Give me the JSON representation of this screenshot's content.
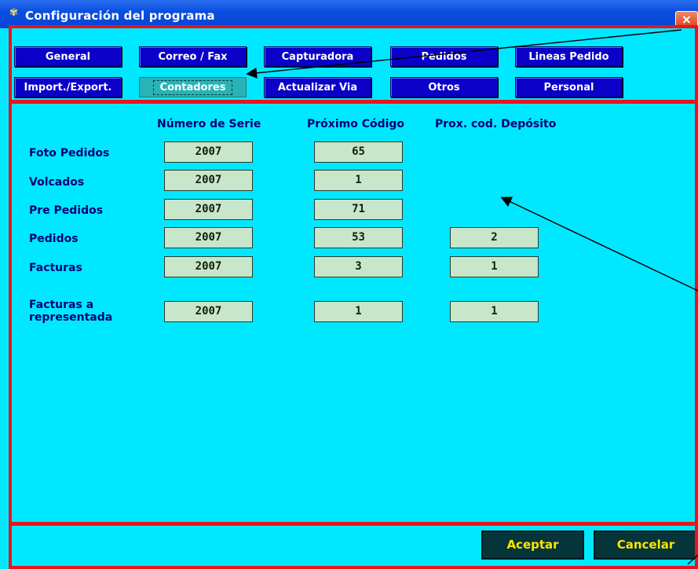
{
  "window": {
    "title": "Configuración del programa",
    "close_label": "×"
  },
  "tabs": [
    {
      "label": "General",
      "active": false
    },
    {
      "label": "Correo / Fax",
      "active": false
    },
    {
      "label": "Capturadora",
      "active": false
    },
    {
      "label": "Pedidos",
      "active": false
    },
    {
      "label": "Lineas Pedido",
      "active": false
    },
    {
      "label": "Import./Export.",
      "active": false
    },
    {
      "label": "Contadores",
      "active": true
    },
    {
      "label": "Actualizar Via",
      "active": false
    },
    {
      "label": "Otros",
      "active": false
    },
    {
      "label": "Personal",
      "active": false
    }
  ],
  "counters": {
    "headers": {
      "serie": "Número de Serie",
      "codigo": "Próximo Código",
      "deposito": "Prox. cod. Depósito"
    },
    "rows": [
      {
        "label": "Foto Pedidos",
        "serie": "2007",
        "codigo": "65",
        "deposito": null
      },
      {
        "label": "Volcados",
        "serie": "2007",
        "codigo": "1",
        "deposito": null
      },
      {
        "label": "Pre Pedidos",
        "serie": "2007",
        "codigo": "71",
        "deposito": null
      },
      {
        "label": "Pedidos",
        "serie": "2007",
        "codigo": "53",
        "deposito": "2"
      },
      {
        "label": "Facturas",
        "serie": "2007",
        "codigo": "3",
        "deposito": "1"
      },
      {
        "label": "Facturas a representada",
        "serie": "2007",
        "codigo": "1",
        "deposito": "1"
      }
    ]
  },
  "footer": {
    "accept_label": "Aceptar",
    "cancel_label": "Cancelar"
  },
  "colors": {
    "background": "#00e8ff",
    "tab": "#0a00c8",
    "tab_active": "#29b3b6",
    "cell": "#c8e6c9",
    "button": "#05343a",
    "button_text": "#ffe500",
    "annotation": "#e8141e"
  }
}
